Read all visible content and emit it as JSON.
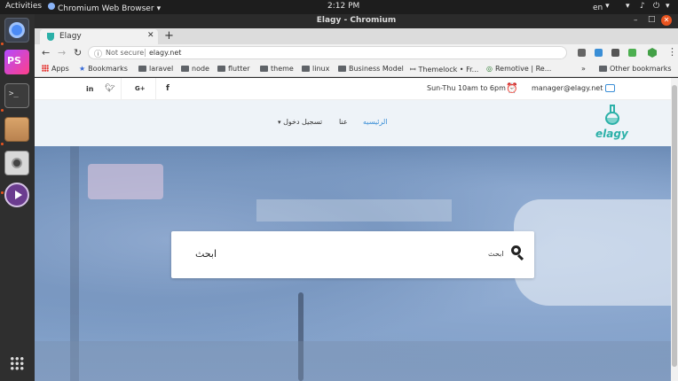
{
  "desktop": {
    "activities": "Activities",
    "app_name": "Chromium Web Browser",
    "clock": "2:12 PM",
    "language": "en"
  },
  "window": {
    "title": "Elagy - Chromium"
  },
  "tab": {
    "title": "Elagy"
  },
  "address": {
    "security": "Not secure",
    "url": "elagy.net"
  },
  "bookmarks": {
    "apps": "Apps",
    "items": [
      "Bookmarks",
      "laravel",
      "node",
      "flutter",
      "theme",
      "linux",
      "Business Model",
      "Themelock • Fr...",
      "Remotive | Re..."
    ],
    "other": "Other bookmarks"
  },
  "site": {
    "hours": "Sun-Thu 10am to 6pm",
    "email": "manager@elagy.net",
    "social": {
      "linkedin": "in",
      "googleplus": "G+",
      "facebook": "f"
    },
    "nav": {
      "home": "الرئيسيه",
      "about": "عنا",
      "login": "تسجيل دخول"
    },
    "logo_text": "elagy",
    "search": {
      "input_value": "ابحث",
      "placeholder": "ابحث"
    }
  },
  "colors": {
    "accent": "#3a8ed6",
    "logo": "#2bb0a8",
    "hero_overlay": "#5f8cc8"
  }
}
